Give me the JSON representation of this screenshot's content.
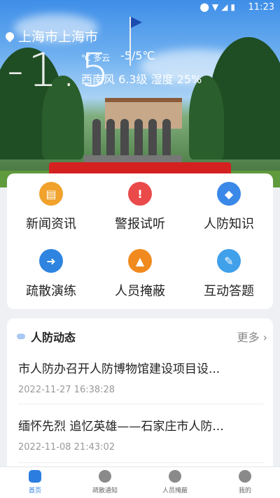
{
  "status_bar": {
    "time": "11:23",
    "icons": [
      "location-icon",
      "wifi-icon",
      "signal-icon",
      "battery-icon"
    ]
  },
  "weather": {
    "location": "上海市上海市",
    "temperature": "-1.5",
    "unit_condition": "℃ 多云",
    "range": "-5/5℃",
    "wind_humidity": "西南风 6.3级 湿度 25%"
  },
  "menu": [
    {
      "label": "新闻资讯",
      "icon": "news-icon",
      "color": "#f0a22d"
    },
    {
      "label": "警报试听",
      "icon": "alert-icon",
      "color": "#ea4a4a"
    },
    {
      "label": "人防知识",
      "icon": "knowledge-icon",
      "color": "#3a88e8"
    },
    {
      "label": "疏散演练",
      "icon": "evacuation-icon",
      "color": "#2f84e0"
    },
    {
      "label": "人员掩蔽",
      "icon": "shelter-icon",
      "color": "#f08a1e"
    },
    {
      "label": "互动答题",
      "icon": "quiz-icon",
      "color": "#41a0ea"
    }
  ],
  "news": {
    "title": "人防动态",
    "more": "更多",
    "items": [
      {
        "title": "市人防办召开人防博物馆建设项目设...",
        "time": "2022-11-27 16:38:28"
      },
      {
        "title": "缅怀先烈 追忆英雄——石家庄市人防...",
        "time": "2022-11-08 21:43:02"
      }
    ]
  },
  "tabbar": [
    {
      "label": "首页",
      "icon": "home-icon",
      "active": true
    },
    {
      "label": "疏散通知",
      "icon": "bell-icon",
      "active": false
    },
    {
      "label": "人员掩蔽",
      "icon": "shield-icon",
      "active": false
    },
    {
      "label": "我的",
      "icon": "user-icon",
      "active": false
    }
  ],
  "colors": {
    "accent": "#2b7de0",
    "alert_red": "#ea4a4a"
  }
}
